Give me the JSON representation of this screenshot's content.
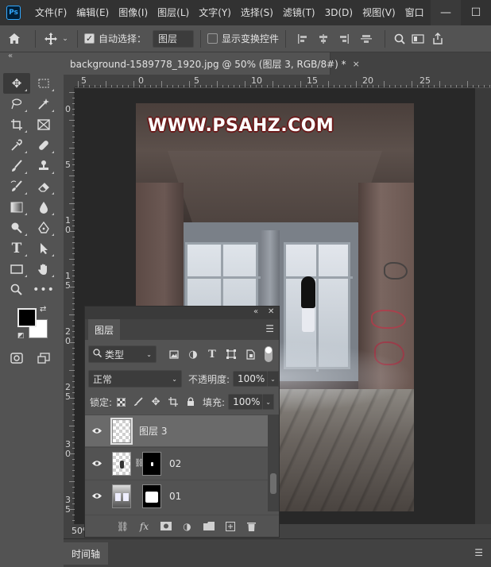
{
  "app": {
    "logo": "Ps"
  },
  "menu": {
    "items": [
      "文件(F)",
      "编辑(E)",
      "图像(I)",
      "图层(L)",
      "文字(Y)",
      "选择(S)",
      "滤镜(T)",
      "3D(D)",
      "视图(V)",
      "窗口"
    ]
  },
  "window": {
    "minimize": "—",
    "maximize": "☐"
  },
  "options": {
    "auto_select_label": "自动选择：",
    "auto_select_target": "图层",
    "show_transform_label": "显示变换控件"
  },
  "document": {
    "tab_title": "background-1589778_1920.jpg @ 50% (图层 3, RGB/8#) *",
    "close": "×",
    "zoom": "50%",
    "watermark": "WWW.PSAHZ.COM"
  },
  "rulers": {
    "top": [
      "5",
      "0",
      "5",
      "10",
      "15",
      "20",
      "25"
    ],
    "left": [
      "0",
      "5",
      "1\n0",
      "1\n5",
      "2\n0",
      "2\n5",
      "3\n0",
      "3\n5"
    ]
  },
  "layers_panel": {
    "tab": "图层",
    "filter_kind": "类型",
    "blend_mode": "正常",
    "opacity_label": "不透明度:",
    "opacity_value": "100%",
    "lock_label": "锁定:",
    "fill_label": "填充:",
    "fill_value": "100%",
    "layers": [
      {
        "name": "图层 3",
        "selected": true
      },
      {
        "name": "02",
        "selected": false
      },
      {
        "name": "01",
        "selected": false
      }
    ]
  },
  "timeline": {
    "tab": "时间轴"
  },
  "colors": {
    "foreground": "#000000",
    "background": "#ffffff",
    "accent": "#31a8ff"
  }
}
